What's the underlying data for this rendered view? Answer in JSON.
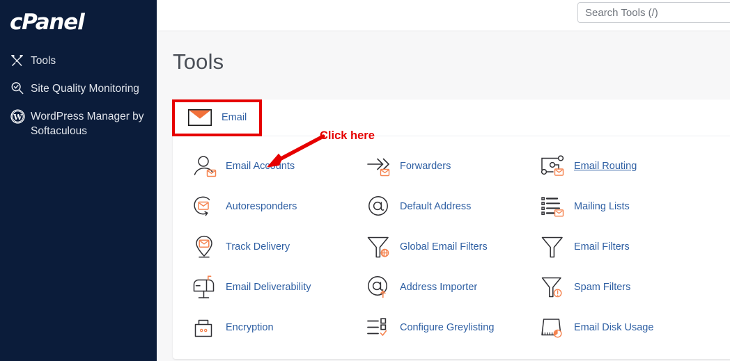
{
  "sidebar": {
    "brand": "cPanel",
    "items": [
      {
        "label": "Tools",
        "icon": "tools-icon"
      },
      {
        "label": "Site Quality Monitoring",
        "icon": "site-quality-monitoring-icon"
      },
      {
        "label": "WordPress Manager by Softaculous",
        "icon": "wordpress-icon"
      }
    ]
  },
  "topbar": {
    "search": {
      "placeholder": "Search Tools (/)",
      "value": ""
    }
  },
  "page": {
    "title": "Tools"
  },
  "section": {
    "title": "Email",
    "icon": "envelope-icon",
    "collapse_icon": "chevron-up-icon",
    "expanded": true,
    "tools": [
      {
        "label": "Email Accounts",
        "icon": "email-accounts-icon",
        "hovered": false
      },
      {
        "label": "Forwarders",
        "icon": "forwarders-icon",
        "hovered": false
      },
      {
        "label": "Email Routing",
        "icon": "email-routing-icon",
        "hovered": true
      },
      {
        "label": "Autoresponders",
        "icon": "autoresponders-icon",
        "hovered": false
      },
      {
        "label": "Default Address",
        "icon": "default-address-icon",
        "hovered": false
      },
      {
        "label": "Mailing Lists",
        "icon": "mailing-lists-icon",
        "hovered": false
      },
      {
        "label": "Track Delivery",
        "icon": "track-delivery-icon",
        "hovered": false
      },
      {
        "label": "Global Email Filters",
        "icon": "global-email-filters-icon",
        "hovered": false
      },
      {
        "label": "Email Filters",
        "icon": "email-filters-icon",
        "hovered": false
      },
      {
        "label": "Email Deliverability",
        "icon": "email-deliverability-icon",
        "hovered": false
      },
      {
        "label": "Address Importer",
        "icon": "address-importer-icon",
        "hovered": false
      },
      {
        "label": "Spam Filters",
        "icon": "spam-filters-icon",
        "hovered": false
      },
      {
        "label": "Encryption",
        "icon": "encryption-icon",
        "hovered": false
      },
      {
        "label": "Configure Greylisting",
        "icon": "configure-greylisting-icon",
        "hovered": false
      },
      {
        "label": "Email Disk Usage",
        "icon": "email-disk-usage-icon",
        "hovered": false
      }
    ]
  },
  "annotations": {
    "click_here_text": "Click here",
    "highlight_color": "#e60000",
    "arrow_color": "#e60000"
  },
  "colors": {
    "sidebar_bg": "#0b1c3a",
    "page_bg": "#f7f7f8",
    "link_blue": "#2e5fa3",
    "accent_orange": "#f5834f",
    "icon_dark": "#2f2f33"
  }
}
